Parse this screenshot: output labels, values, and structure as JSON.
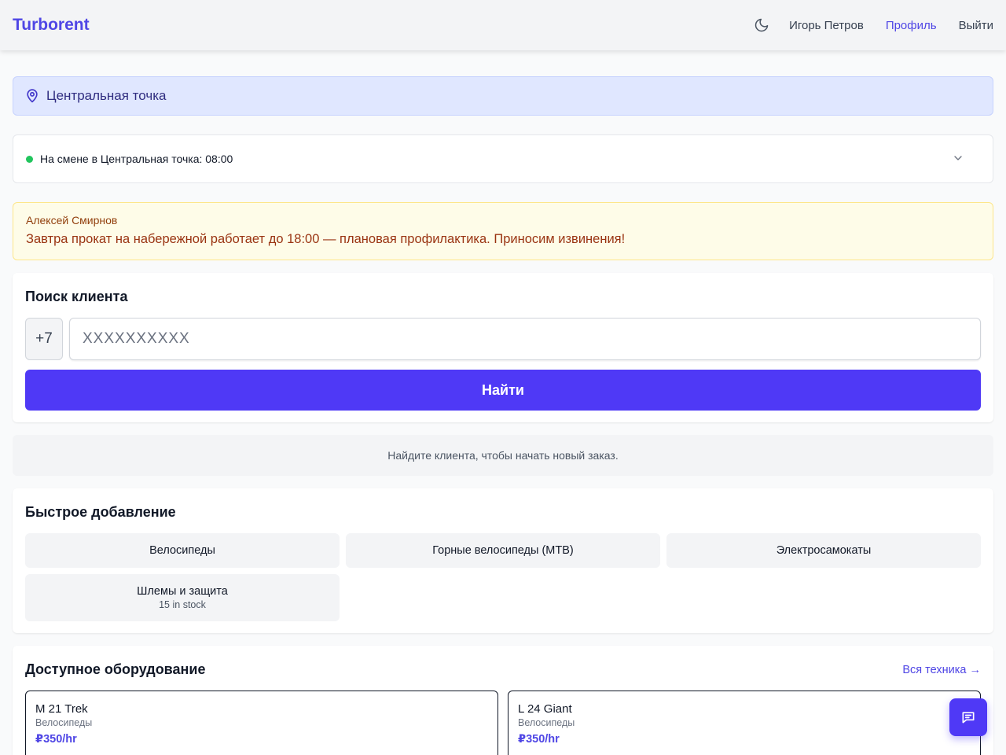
{
  "header": {
    "brand": "Turborent",
    "user_name": "Игорь Петров",
    "profile_label": "Профиль",
    "logout_label": "Выйти"
  },
  "location": {
    "name": "Центральная точка"
  },
  "shift": {
    "status_text": "На смене в Центральная точка: 08:00"
  },
  "notice": {
    "author": "Алексей Смирнов",
    "message": "Завтра прокат на набережной работает до 18:00 — плановая профилактика. Приносим извинения!"
  },
  "search": {
    "title": "Поиск клиента",
    "prefix": "+7",
    "placeholder": "XXXXXXXXXX",
    "value": "",
    "button_label": "Найти"
  },
  "hint": "Найдите клиента, чтобы начать новый заказ.",
  "quick_add": {
    "title": "Быстрое добавление",
    "items": [
      {
        "label": "Велосипеды",
        "stock": ""
      },
      {
        "label": "Горные велосипеды (MTB)",
        "stock": ""
      },
      {
        "label": "Электросамокаты",
        "stock": ""
      },
      {
        "label": "Шлемы и защита",
        "stock": "15 in stock"
      }
    ]
  },
  "equipment": {
    "title": "Доступное оборудование",
    "all_link": "Вся техника →",
    "items": [
      {
        "name": "M 21 Trek",
        "category": "Велосипеды",
        "price": "₽350/hr"
      },
      {
        "name": "L 24 Giant",
        "category": "Велосипеды",
        "price": "₽350/hr"
      }
    ]
  },
  "colors": {
    "accent": "#4f39f6",
    "brand": "#4f46e5",
    "online": "#22c55e"
  },
  "icons": {
    "theme": "moon-icon",
    "location": "map-pin-icon",
    "expand": "chevron-down-icon",
    "chat": "chat-icon"
  }
}
